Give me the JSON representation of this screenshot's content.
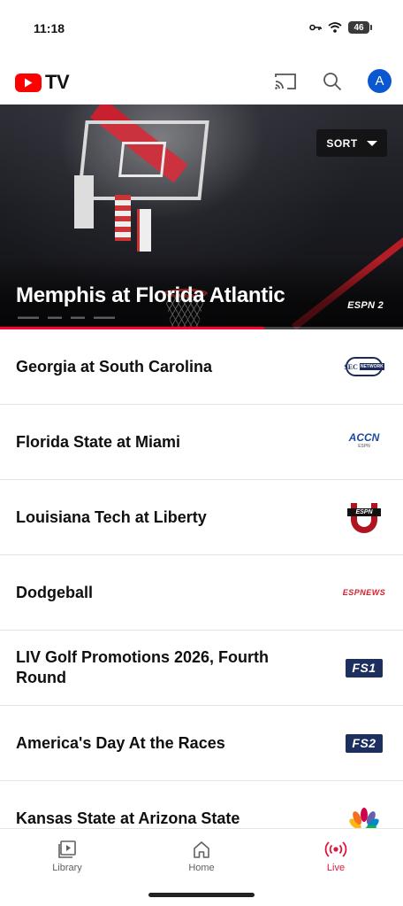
{
  "status_bar": {
    "time": "11:18",
    "battery": "46"
  },
  "header": {
    "logo_text": "TV",
    "brand_color": "#ff0000",
    "avatar_initial": "A",
    "avatar_color": "#0b57d0",
    "icons": [
      "cast-icon",
      "search-icon"
    ]
  },
  "hero": {
    "title": "Memphis at Florida Atlantic",
    "network": "ESPN 2",
    "sort_label": "SORT",
    "progress_fraction": 0.655,
    "progress_color": "#ff0033"
  },
  "channels": [
    {
      "title": "Georgia at South Carolina",
      "network": "SEC Network",
      "logo_text": "SEC",
      "logo_subtext": "NETWORK"
    },
    {
      "title": "Florida State at Miami",
      "network": "ACC Network",
      "logo_text": "ACCN",
      "logo_subtext": "ESPN"
    },
    {
      "title": "Louisiana Tech at Liberty",
      "network": "ESPNU",
      "logo_text": "ESPN"
    },
    {
      "title": "Dodgeball",
      "network": "ESPNEWS",
      "logo_text": "ESPNEWS"
    },
    {
      "title": "LIV Golf Promotions 2026, Fourth Round",
      "network": "FS1",
      "logo_text": "FS1"
    },
    {
      "title": "America's Day At the Races",
      "network": "FS2",
      "logo_text": "FS2"
    },
    {
      "title": "Kansas State at Arizona State",
      "network": "NBC",
      "logo_text": ""
    }
  ],
  "bottom_nav": {
    "items": [
      {
        "label": "Library",
        "icon": "library-icon",
        "active": false
      },
      {
        "label": "Home",
        "icon": "home-icon",
        "active": false
      },
      {
        "label": "Live",
        "icon": "live-icon",
        "active": true
      }
    ],
    "active_color": "#e0143c"
  }
}
